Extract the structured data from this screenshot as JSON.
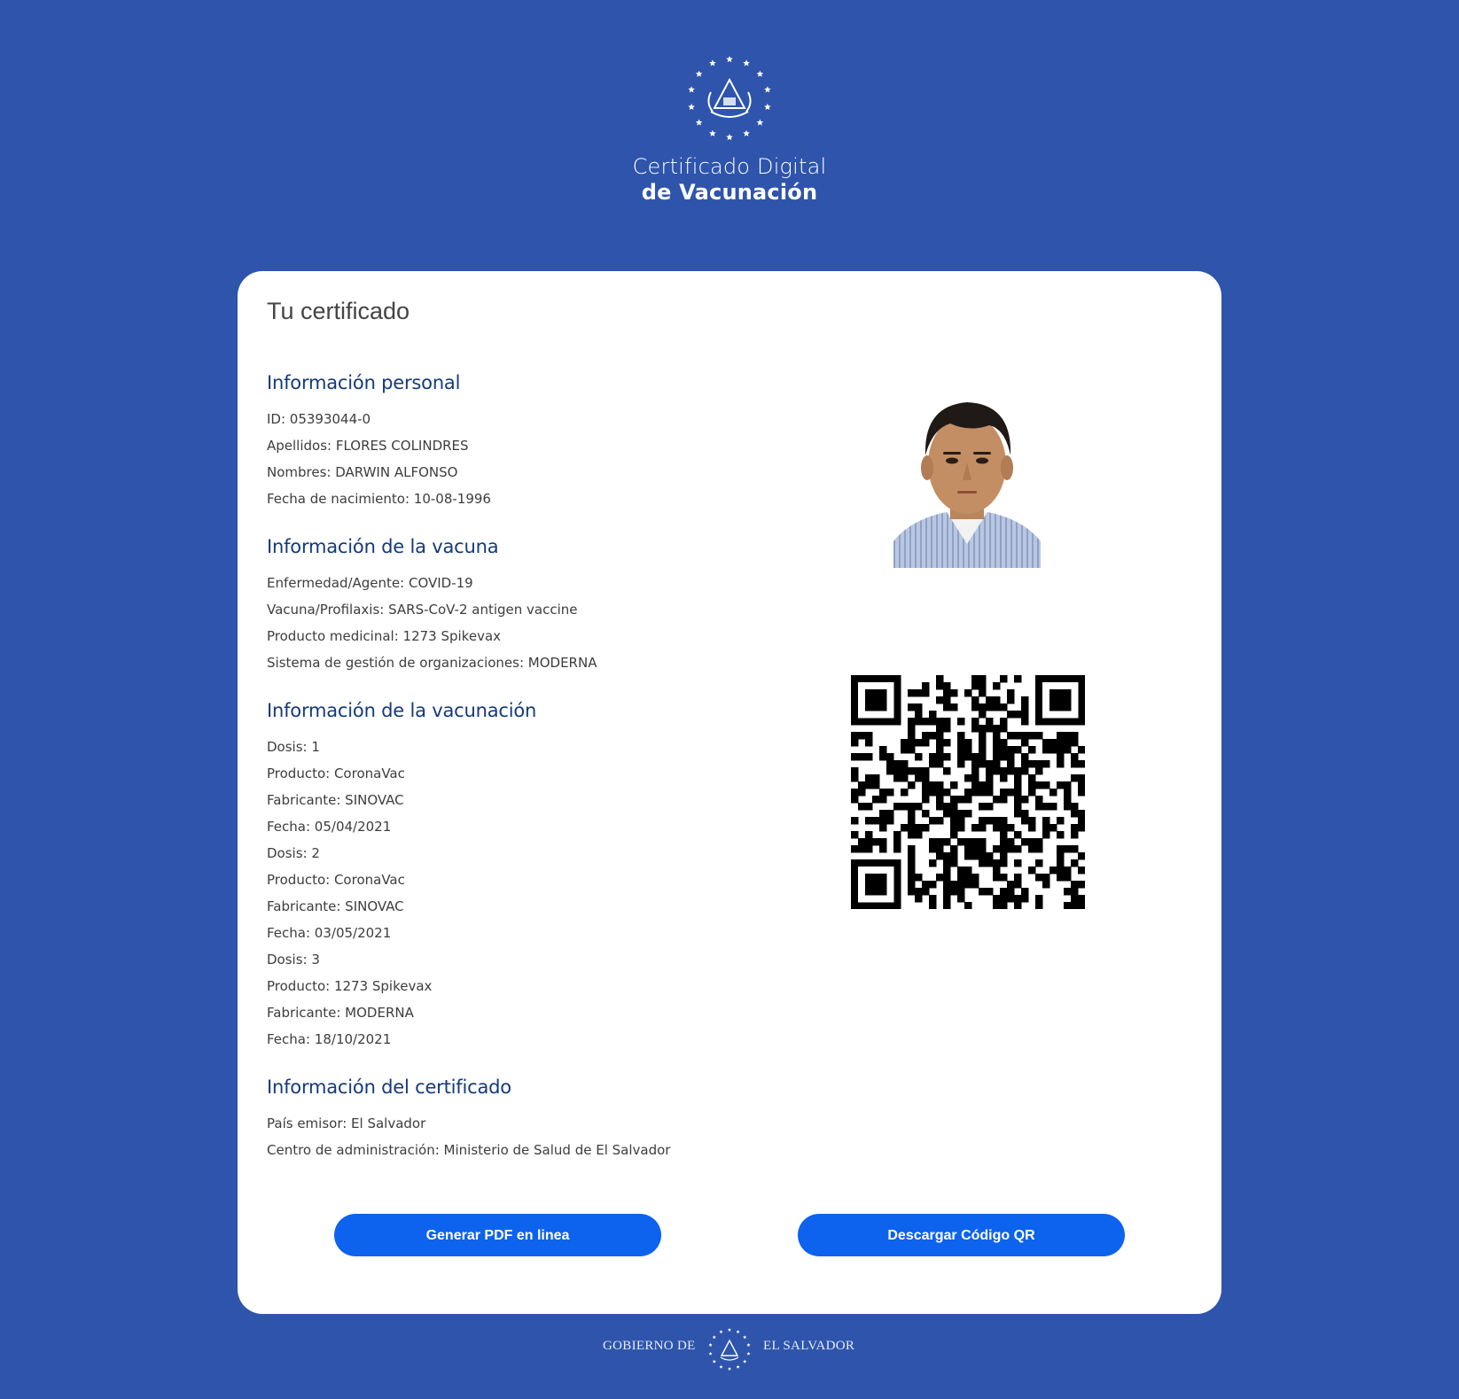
{
  "header": {
    "title_line1": "Certificado Digital",
    "title_line2": "de Vacunación",
    "seal_icon": "el-salvador-coat-of-arms-icon"
  },
  "card": {
    "title": "Tu certificado",
    "sections": {
      "personal": {
        "heading": "Información personal",
        "fields": [
          "ID: 05393044-0",
          "Apellidos: FLORES COLINDRES",
          "Nombres: DARWIN ALFONSO",
          "Fecha de nacimiento: 10-08-1996"
        ]
      },
      "vaccine": {
        "heading": "Información de la vacuna",
        "fields": [
          "Enfermedad/Agente: COVID-19",
          "Vacuna/Profilaxis: SARS-CoV-2 antigen vaccine",
          "Producto medicinal: 1273 Spikevax",
          "Sistema de gestión de organizaciones: MODERNA"
        ]
      },
      "vaccination": {
        "heading": "Información de la vacunación",
        "fields": [
          "Dosis: 1",
          "Producto: CoronaVac",
          "Fabricante: SINOVAC",
          "Fecha: 05/04/2021",
          "Dosis: 2",
          "Producto: CoronaVac",
          "Fabricante: SINOVAC",
          "Fecha: 03/05/2021",
          "Dosis: 3",
          "Producto: 1273 Spikevax",
          "Fabricante: MODERNA",
          "Fecha: 18/10/2021"
        ]
      },
      "certificate": {
        "heading": "Información del certificado",
        "fields": [
          "País emisor: El Salvador",
          "Centro de administración: Ministerio de Salud de El Salvador"
        ]
      }
    },
    "buttons": {
      "pdf_label": "Generar PDF en linea",
      "qr_label": "Descargar Código QR"
    }
  },
  "footer": {
    "left_text": "GOBIERNO DE",
    "right_text": "EL SALVADOR"
  },
  "colors": {
    "background": "#2e54ac",
    "button": "#0d62ee",
    "heading": "#143a7a"
  }
}
